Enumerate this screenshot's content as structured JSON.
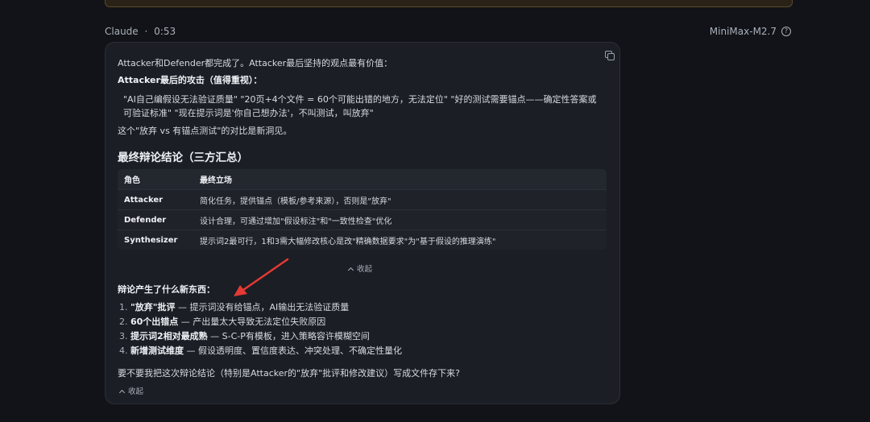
{
  "message": {
    "author": "Claude",
    "separator": "·",
    "duration": "0:53",
    "model": "MiniMax-M2.7",
    "help_icon": "?"
  },
  "content": {
    "intro": "Attacker和Defender都完成了。Attacker最后坚持的观点最有价值：",
    "attack_heading": "Attacker最后的攻击（值得重视）：",
    "quote_line1": "\"AI自己编假设无法验证质量\" \"20页+4个文件 = 60个可能出错的地方，无法定位\" \"好的测试需要锚点——确定性答案或",
    "quote_line2": "可验证标准\" \"现在提示词是'你自己想办法'，不叫测试，叫放弃\"",
    "insight": "这个\"放弃 vs 有锚点测试\"的对比是新洞见。",
    "section_title": "最终辩论结论（三方汇总）",
    "table": {
      "headers": [
        "角色",
        "最终立场"
      ],
      "rows": [
        {
          "role": "Attacker",
          "stance": "简化任务，提供锚点（模板/参考来源），否则是\"放弃\""
        },
        {
          "role": "Defender",
          "stance": "设计合理，可通过增加\"假设标注\"和\"一致性检查\"优化"
        },
        {
          "role": "Synthesizer",
          "stance": "提示词2最可行，1和3需大幅修改核心是改\"精确数据要求\"为\"基于假设的推理演练\""
        }
      ]
    },
    "table_collapse": "收起",
    "new_heading": "辩论产生了什么新东西：",
    "list": [
      {
        "num": "1.",
        "bold": "\"放弃\"批评",
        "rest": " — 提示词没有给锚点，AI输出无法验证质量"
      },
      {
        "num": "2.",
        "bold": "60个出错点",
        "rest": " — 产出量太大导致无法定位失败原因"
      },
      {
        "num": "3.",
        "bold": "提示词2相对最成熟",
        "rest": " — S-C-P有模板，进入策略容许模糊空间"
      },
      {
        "num": "4.",
        "bold": "新增测试维度",
        "rest": " — 假设透明度、置信度表达、冲突处理、不确定性量化"
      }
    ],
    "question": "要不要我把这次辩论结论（特别是Attacker的\"放弃\"批评和修改建议）写成文件存下来?",
    "bottom_collapse": "收起"
  },
  "colors": {
    "background": "#111318",
    "card": "#1b1e24",
    "arrow": "#e53935"
  }
}
